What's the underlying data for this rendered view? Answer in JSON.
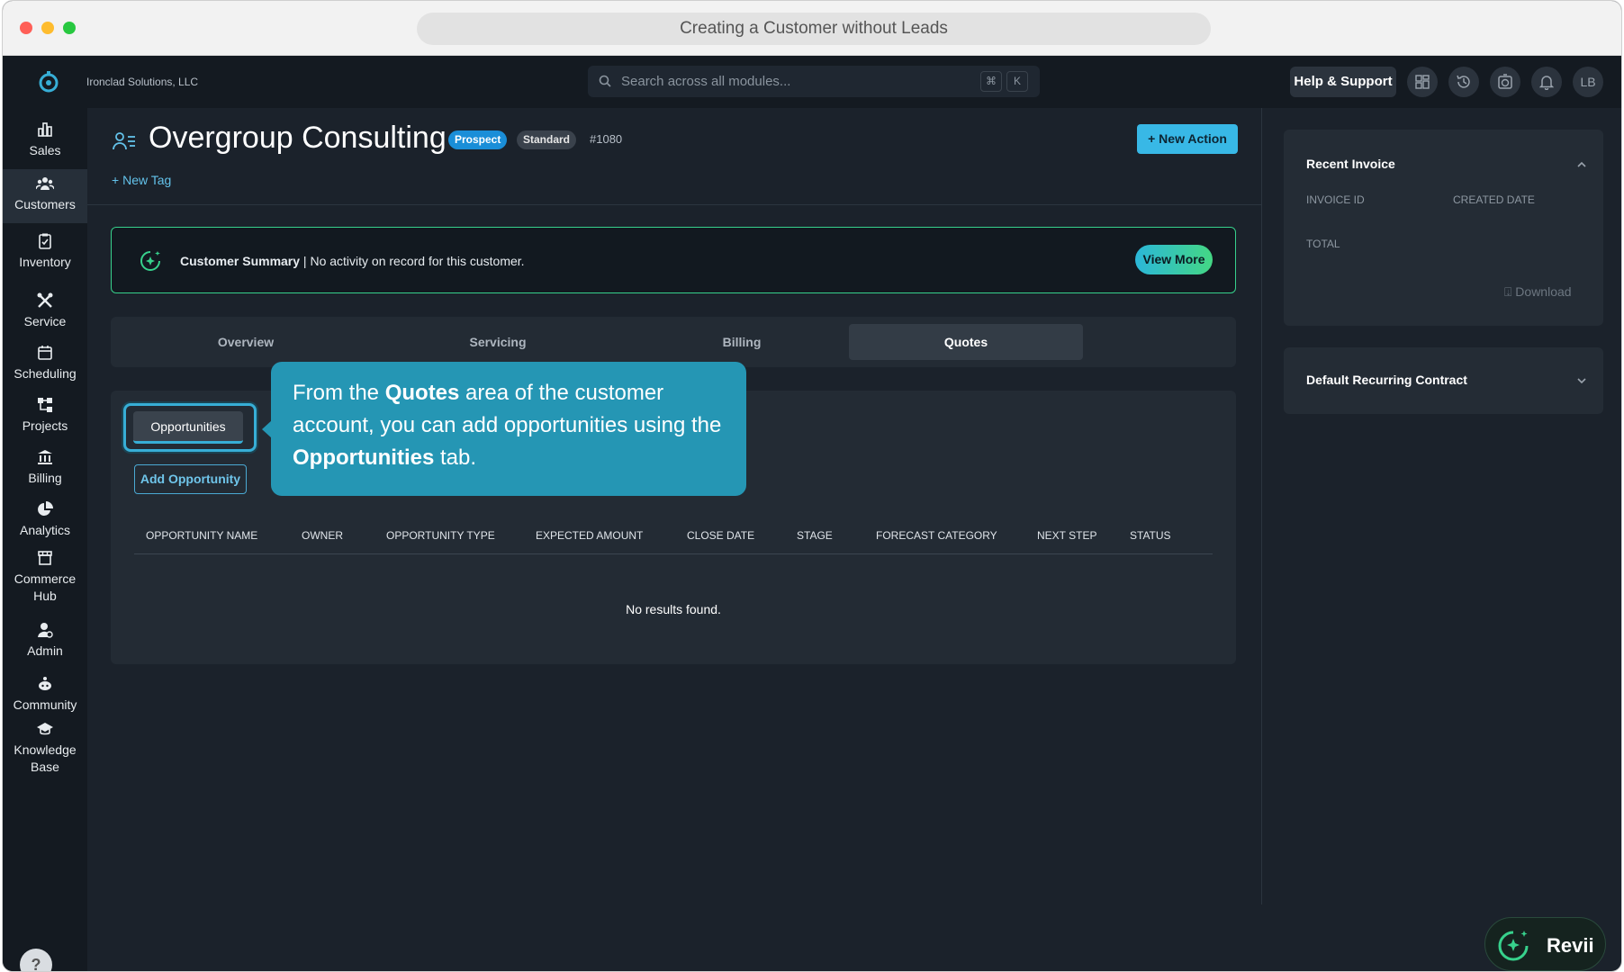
{
  "window": {
    "title": "Creating a Customer without Leads"
  },
  "topbar": {
    "company": "Ironclad Solutions, LLC",
    "search_placeholder": "Search across all modules...",
    "kbd_cmd": "⌘",
    "kbd_k": "K",
    "help_label": "Help & Support",
    "avatar_initials": "LB"
  },
  "sidebar": {
    "items": [
      {
        "label": "Sales",
        "icon": "bar-chart-icon"
      },
      {
        "label": "Customers",
        "icon": "users-icon",
        "active": true
      },
      {
        "label": "Inventory",
        "icon": "clipboard-check-icon"
      },
      {
        "label": "Service",
        "icon": "tools-icon"
      },
      {
        "label": "Scheduling",
        "icon": "calendar-icon"
      },
      {
        "label": "Projects",
        "icon": "hierarchy-icon"
      },
      {
        "label": "Billing",
        "icon": "bank-icon"
      },
      {
        "label": "Analytics",
        "icon": "pie-chart-icon"
      },
      {
        "label": "Commerce Hub",
        "icon": "storefront-icon"
      },
      {
        "label": "Admin",
        "icon": "user-gear-icon"
      },
      {
        "label": "Community",
        "icon": "community-icon"
      },
      {
        "label": "Knowledge Base",
        "icon": "graduation-cap-icon"
      }
    ],
    "help": "?"
  },
  "customer": {
    "name": "Overgroup Consulting",
    "badge_status": "Prospect",
    "badge_tier": "Standard",
    "id": "#1080",
    "new_action_label": "New Action",
    "new_tag_label": "New Tag"
  },
  "summary": {
    "title": "Customer Summary",
    "separator": " | ",
    "text": "No activity on record for this customer.",
    "view_more": "View More"
  },
  "tabs": [
    {
      "label": "Overview"
    },
    {
      "label": "Servicing"
    },
    {
      "label": "Billing"
    },
    {
      "label": "Quotes",
      "active": true
    }
  ],
  "quotes": {
    "subtab": "Opportunities",
    "add_button": "Add Opportunity",
    "columns": [
      "OPPORTUNITY NAME",
      "OWNER",
      "OPPORTUNITY TYPE",
      "EXPECTED AMOUNT",
      "CLOSE DATE",
      "STAGE",
      "FORECAST CATEGORY",
      "NEXT STEP",
      "STATUS"
    ],
    "empty": "No results found."
  },
  "callout": {
    "part1": "From the ",
    "bold1": "Quotes",
    "part2": " area of the customer account, you can add opportunities using the ",
    "bold2": "Opportunities",
    "part3": " tab."
  },
  "right": {
    "recent_invoice": {
      "title": "Recent Invoice",
      "invoice_id_label": "INVOICE ID",
      "created_label": "CREATED DATE",
      "total_label": "TOTAL",
      "download": "Download"
    },
    "contract": {
      "title": "Default Recurring Contract"
    }
  },
  "revii": {
    "label": "Revii"
  },
  "colors": {
    "accent": "#38b8e6",
    "summary_border": "#37d18c",
    "callout": "#2596b4",
    "prospect": "#1a8ed8"
  }
}
